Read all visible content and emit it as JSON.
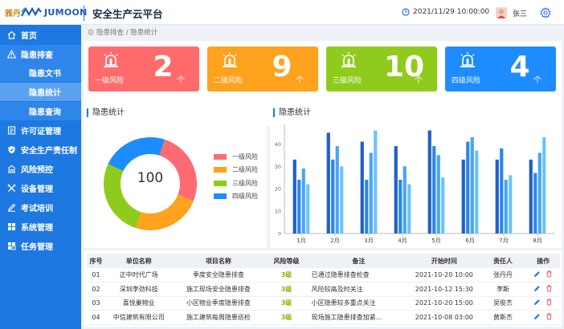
{
  "header": {
    "logo_cn": "雅丹",
    "logo_en": "JUMOON",
    "system_title": "安全生产云平台",
    "datetime": "2021/11/29  10:00:00",
    "username": "张三"
  },
  "sidebar": {
    "items": [
      {
        "label": "首页",
        "icon": "home-icon"
      },
      {
        "label": "隐患排查",
        "icon": "warning-icon"
      },
      {
        "label": "隐患文书"
      },
      {
        "label": "隐患统计"
      },
      {
        "label": "隐患查询"
      },
      {
        "label": "许可证管理",
        "icon": "license-icon"
      },
      {
        "label": "安全生产责任制",
        "icon": "shield-icon"
      },
      {
        "label": "风险预控",
        "icon": "building-icon"
      },
      {
        "label": "设备管理",
        "icon": "tools-icon"
      },
      {
        "label": "考试培训",
        "icon": "exam-icon"
      },
      {
        "label": "系统管理",
        "icon": "grid-icon"
      },
      {
        "label": "任务管理",
        "icon": "task-icon"
      }
    ],
    "active": "隐患统计"
  },
  "breadcrumb": "隐患排查 / 隐患统计",
  "kpis": [
    {
      "label": "一级风险",
      "value": "2",
      "unit": "个",
      "color": "#ff6b6b"
    },
    {
      "label": "二级风险",
      "value": "9",
      "unit": "个",
      "color": "#ffa21d"
    },
    {
      "label": "三级风险",
      "value": "10",
      "unit": "个",
      "color": "#8fcb1c"
    },
    {
      "label": "四级风险",
      "value": "4",
      "unit": "个",
      "color": "#1d8cff"
    }
  ],
  "donut_panel": {
    "title": "隐患统计",
    "center_value": "100"
  },
  "bar_panel": {
    "title": "隐患统计"
  },
  "chart_data": [
    {
      "type": "pie",
      "categories": [
        "一级风险",
        "二级风险",
        "三级风险",
        "四级风险"
      ],
      "values": [
        26,
        24,
        27,
        23
      ],
      "colors": [
        "#ff6b72",
        "#ffa21d",
        "#8fcb1c",
        "#1d8cff"
      ],
      "legend": "right"
    },
    {
      "type": "bar",
      "categories": [
        "1月",
        "2月",
        "3月",
        "4月",
        "5月",
        "6月",
        "7月",
        "8月"
      ],
      "series": [
        {
          "values": [
            33,
            45,
            41,
            39,
            46,
            33,
            33,
            33
          ],
          "color": "#1f5fc6"
        },
        {
          "values": [
            24,
            33,
            24,
            24,
            39,
            41,
            38,
            27
          ],
          "color": "#2b86ea"
        },
        {
          "values": [
            29,
            39,
            36,
            30,
            35,
            43,
            24,
            36
          ],
          "color": "#4ba5f2"
        },
        {
          "values": [
            22,
            30,
            46,
            22,
            25,
            37,
            26,
            43
          ],
          "color": "#6cc3fa"
        }
      ],
      "yticks": [
        0,
        10,
        20,
        30,
        40
      ],
      "ylim": [
        0,
        48
      ]
    }
  ],
  "table": {
    "columns": [
      "序号",
      "单位名称",
      "项目名称",
      "风险等级",
      "备注",
      "开始时间",
      "责任人",
      "操作"
    ],
    "rows": [
      [
        "01",
        "正中时代广场",
        "季度安全隐患排查",
        "3级",
        "已通过隐患排查检查",
        "2021-10-20 10:00",
        "张丹丹"
      ],
      [
        "02",
        "深圳李劲科技",
        "施工现场安全隐患排查",
        "3级",
        "风险较高及时关注",
        "2021-10-12 15:30",
        "李斯"
      ],
      [
        "03",
        "喜悦巢物业",
        "小区物业季度隐患排查",
        "3级",
        "小区隐患较多重点关注",
        "2021-10-20 15:00",
        "吴俊杰"
      ],
      [
        "04",
        "中信建筑有限公司",
        "施工建筑每周隐患巡检",
        "3级",
        "现场施工隐患排查加紧...",
        "2021-10-08 03:00",
        "黄斯杰"
      ]
    ]
  }
}
